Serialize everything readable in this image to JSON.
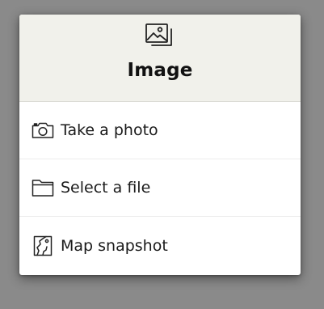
{
  "menu": {
    "title": "Image",
    "header_icon": "image-icon",
    "items": [
      {
        "label": "Take a photo",
        "icon": "camera-icon"
      },
      {
        "label": "Select a file",
        "icon": "folder-icon"
      },
      {
        "label": "Map snapshot",
        "icon": "map-snapshot-icon"
      }
    ]
  }
}
